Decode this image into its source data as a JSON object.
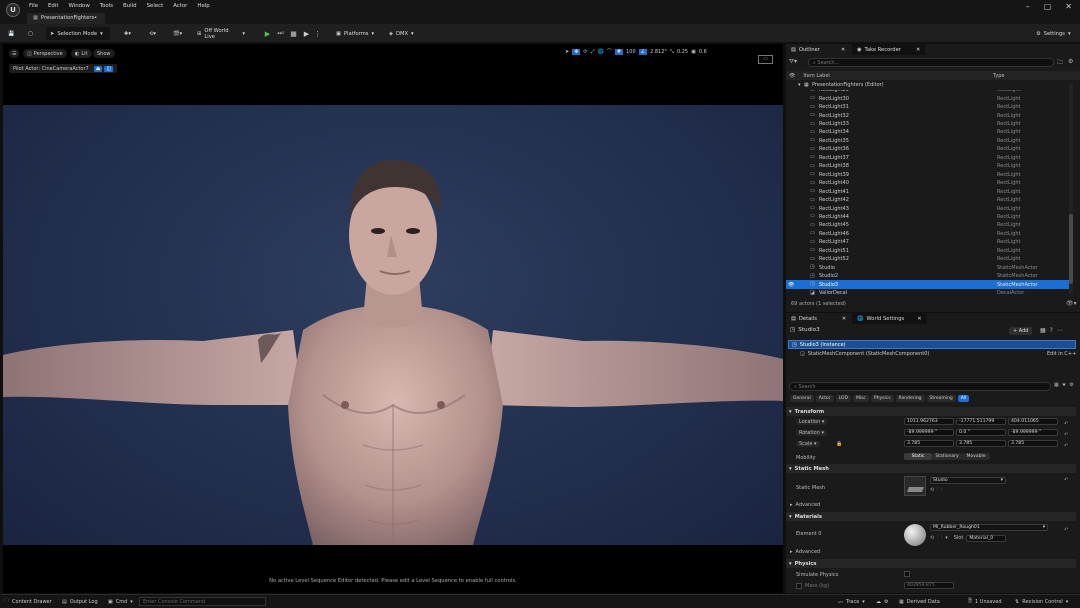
{
  "menu": [
    "File",
    "Edit",
    "Window",
    "Tools",
    "Build",
    "Select",
    "Actor",
    "Help"
  ],
  "doc_tab": "PresentationFighters•",
  "toolbar": {
    "selection_mode": "Selection Mode",
    "world_mode": "Off World Live",
    "platforms": "Platforms",
    "dmx": "DMX",
    "settings": "Settings"
  },
  "viewport": {
    "perspective": "Perspective",
    "lit": "Lit",
    "show": "Show",
    "pilot": "Pilot Actor: CineCameraActor7",
    "grid_size": "100",
    "rot_snap": "2.812°",
    "scale_snap": "0.25",
    "cam_speed": "0.6",
    "message": "No active Level Sequence Editor detected. Please edit a Level Sequence to enable full controls."
  },
  "outliner": {
    "tab": "Outliner",
    "tab2": "Take Recorder",
    "search_placeholder": "Search...",
    "col_label": "Item Label",
    "col_type": "Type",
    "root": "PresentationFighters (Editor)",
    "rows": [
      {
        "label": "RectLight29",
        "type": "RectLight"
      },
      {
        "label": "RectLight30",
        "type": "RectLight"
      },
      {
        "label": "RectLight31",
        "type": "RectLight"
      },
      {
        "label": "RectLight32",
        "type": "RectLight"
      },
      {
        "label": "RectLight33",
        "type": "RectLight"
      },
      {
        "label": "RectLight34",
        "type": "RectLight"
      },
      {
        "label": "RectLight35",
        "type": "RectLight"
      },
      {
        "label": "RectLight36",
        "type": "RectLight"
      },
      {
        "label": "RectLight37",
        "type": "RectLight"
      },
      {
        "label": "RectLight38",
        "type": "RectLight"
      },
      {
        "label": "RectLight39",
        "type": "RectLight"
      },
      {
        "label": "RectLight40",
        "type": "RectLight"
      },
      {
        "label": "RectLight41",
        "type": "RectLight"
      },
      {
        "label": "RectLight42",
        "type": "RectLight"
      },
      {
        "label": "RectLight43",
        "type": "RectLight"
      },
      {
        "label": "RectLight44",
        "type": "RectLight"
      },
      {
        "label": "RectLight45",
        "type": "RectLight"
      },
      {
        "label": "RectLight46",
        "type": "RectLight"
      },
      {
        "label": "RectLight47",
        "type": "RectLight"
      },
      {
        "label": "RectLight51",
        "type": "RectLight"
      },
      {
        "label": "RectLight52",
        "type": "RectLight"
      },
      {
        "label": "Studio",
        "type": "StaticMeshActor"
      },
      {
        "label": "Studio2",
        "type": "StaticMeshActor"
      },
      {
        "label": "Studio3",
        "type": "StaticMeshActor",
        "selected": true
      },
      {
        "label": "ValiorDecal",
        "type": "DecalActor"
      }
    ],
    "status": "69 actors (1 selected)"
  },
  "details": {
    "tab": "Details",
    "tab2": "World Settings",
    "actor_name": "Studio3",
    "add": "+ Add",
    "instance": "Studio3 (Instance)",
    "component": "StaticMeshComponent (StaticMeshComponent0)",
    "edit_cpp": "Edit in C++",
    "search_placeholder": "Search",
    "cats": [
      "General",
      "Actor",
      "LOD",
      "Misc",
      "Physics",
      "Rendering",
      "Streaming",
      "All"
    ],
    "transform_title": "Transform",
    "location_label": "Location",
    "location": [
      "1011.962763",
      "-17771.511799",
      "404.011065"
    ],
    "rotation_label": "Rotation",
    "rotation": [
      "-89.999999 °",
      "0.0 °",
      "-89.999999 °"
    ],
    "scale_label": "Scale",
    "scale": [
      "3.785",
      "3.785",
      "3.785"
    ],
    "mobility_label": "Mobility",
    "mobility": [
      "Static",
      "Stationary",
      "Movable"
    ],
    "static_mesh_title": "Static Mesh",
    "static_mesh_label": "Static Mesh",
    "static_mesh_value": "Studio",
    "advanced": "Advanced",
    "materials_title": "Materials",
    "element0": "Element 0",
    "material_value": "MI_Rubber_Rough01",
    "slot_label": "Slot",
    "slot_value": "Material_0",
    "physics_title": "Physics",
    "simulate_physics": "Simulate Physics",
    "mass_label": "Mass (kg)",
    "mass_value": "402959.875"
  },
  "bottom": {
    "content_drawer": "Content Drawer",
    "output_log": "Output Log",
    "cmd": "Cmd",
    "console_placeholder": "Enter Console Command",
    "trace": "Trace",
    "derived_data": "Derived Data",
    "unsaved": "1 Unsaved",
    "revision": "Revision Control"
  },
  "colors": {
    "accent": "#1a6fd6",
    "play_green": "#4ec94e",
    "bg": "#1a1a1a"
  }
}
